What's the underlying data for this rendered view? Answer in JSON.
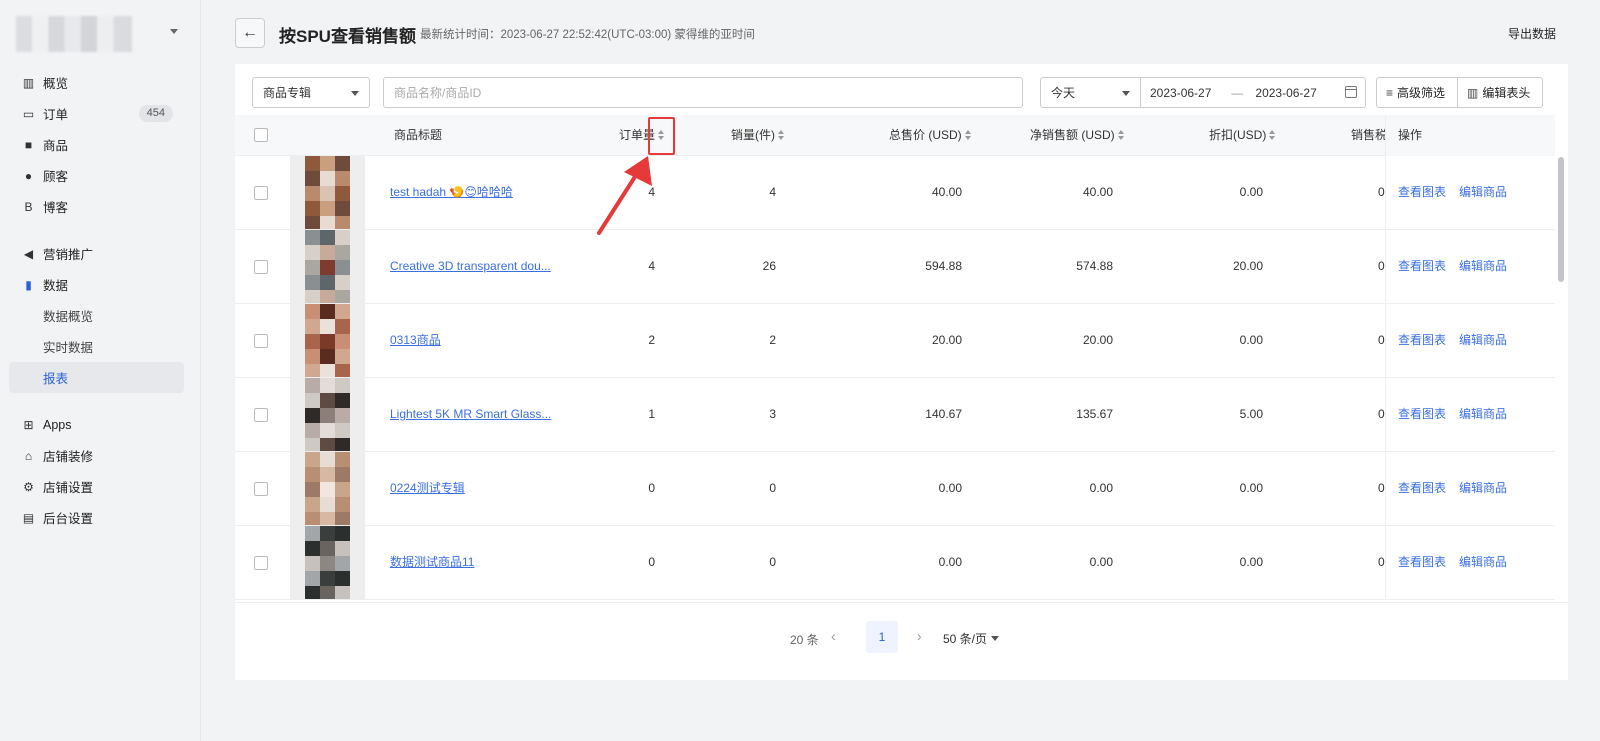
{
  "sidebar": {
    "items": [
      {
        "label": "概览",
        "icon": "dashboard-icon"
      },
      {
        "label": "订单",
        "icon": "inbox-icon",
        "badge": "454"
      },
      {
        "label": "商品",
        "icon": "bag-icon"
      },
      {
        "label": "顾客",
        "icon": "user-icon"
      },
      {
        "label": "博客",
        "icon": "blog-icon"
      },
      {
        "label": "营销推广",
        "icon": "megaphone-icon"
      },
      {
        "label": "数据",
        "icon": "bar-chart-icon"
      },
      {
        "label": "数据概览"
      },
      {
        "label": "实时数据"
      },
      {
        "label": "报表"
      },
      {
        "label": "Apps",
        "icon": "apps-icon"
      },
      {
        "label": "店铺装修",
        "icon": "storefront-icon"
      },
      {
        "label": "店铺设置",
        "icon": "gear-icon"
      },
      {
        "label": "后台设置",
        "icon": "server-icon"
      }
    ]
  },
  "header": {
    "title": "按SPU查看销售额",
    "stat_time": "最新统计时间：2023-06-27 22:52:42(UTC-03:00) 蒙得维的亚时间",
    "export_label": "导出数据"
  },
  "filters": {
    "category_select": "商品专辑",
    "search_placeholder": "商品名称/商品ID",
    "period_select": "今天",
    "date_start": "2023-06-27",
    "date_sep": "—",
    "date_end": "2023-06-27",
    "advanced_label": "高级筛选",
    "edit_header_label": "编辑表头"
  },
  "table": {
    "columns": {
      "title": "商品标题",
      "orders": "订单量",
      "qty": "销量(件)",
      "total": "总售价 (USD)",
      "net": "净销售额 (USD)",
      "discount": "折扣(USD)",
      "tax": "销售税(USD",
      "ops": "操作"
    },
    "op_view": "查看图表",
    "op_edit": "编辑商品",
    "rows": [
      {
        "title": "test hadah 🍤😊哈哈哈",
        "orders": "4",
        "qty": "4",
        "total": "40.00",
        "net": "40.00",
        "discount": "0.00",
        "tax": "0"
      },
      {
        "title": "Creative 3D transparent dou...",
        "orders": "4",
        "qty": "26",
        "total": "594.88",
        "net": "574.88",
        "discount": "20.00",
        "tax": "0"
      },
      {
        "title": "0313商品",
        "orders": "2",
        "qty": "2",
        "total": "20.00",
        "net": "20.00",
        "discount": "0.00",
        "tax": "0"
      },
      {
        "title": "Lightest 5K MR Smart Glass...",
        "orders": "1",
        "qty": "3",
        "total": "140.67",
        "net": "135.67",
        "discount": "5.00",
        "tax": "0"
      },
      {
        "title": "0224测试专辑",
        "orders": "0",
        "qty": "0",
        "total": "0.00",
        "net": "0.00",
        "discount": "0.00",
        "tax": "0"
      },
      {
        "title": "数据测试商品11",
        "orders": "0",
        "qty": "0",
        "total": "0.00",
        "net": "0.00",
        "discount": "0.00",
        "tax": "0"
      }
    ]
  },
  "pager": {
    "total": "20 条",
    "current_page": "1",
    "page_size": "50 条/页"
  },
  "colors": {
    "accent": "#2b5fd9",
    "link": "#3b6fe0",
    "annotation": "#e63a3a"
  }
}
